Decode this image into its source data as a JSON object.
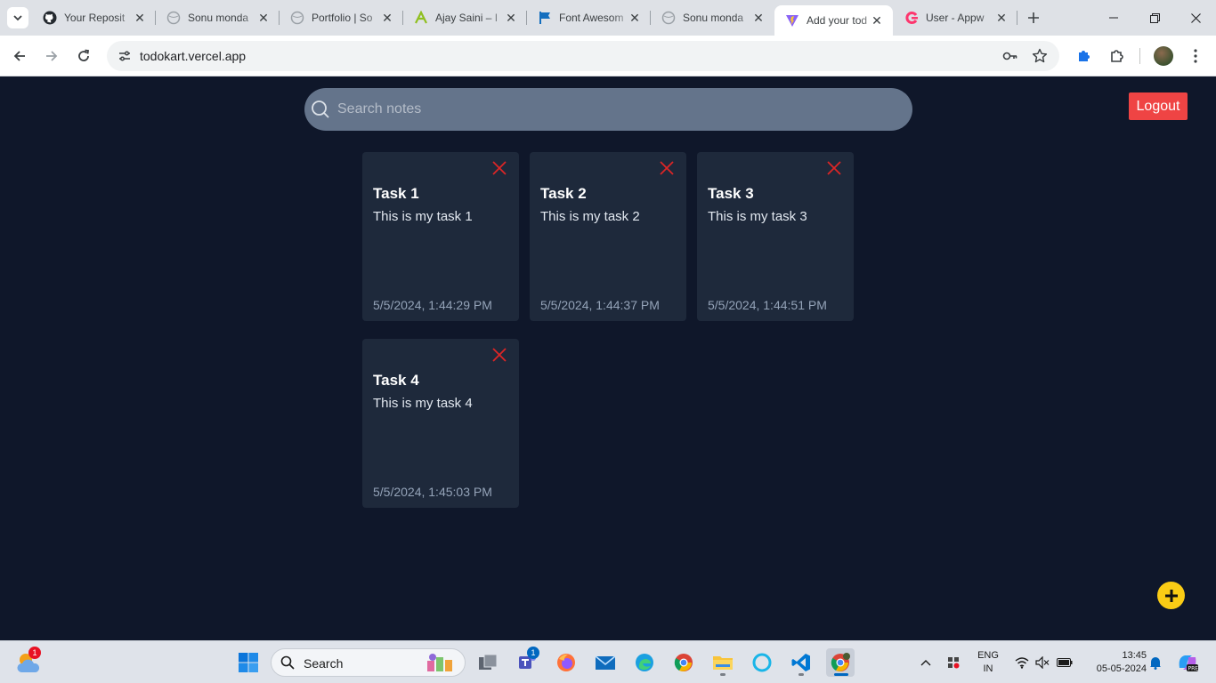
{
  "browser": {
    "tabs": [
      {
        "title": "Your Reposit",
        "icon": "github-icon",
        "active": false
      },
      {
        "title": "Sonu monda",
        "icon": "globe-icon",
        "active": false
      },
      {
        "title": "Portfolio | So",
        "icon": "globe-icon",
        "active": false
      },
      {
        "title": "Ajay Saini – I",
        "icon": "ajay-logo-icon",
        "active": false
      },
      {
        "title": "Font Awesom",
        "icon": "font-awesome-flag-icon",
        "active": false
      },
      {
        "title": "Sonu monda",
        "icon": "globe-icon",
        "active": false
      },
      {
        "title": "Add your tod",
        "icon": "vite-icon",
        "active": true
      },
      {
        "title": "User - Appw",
        "icon": "appwrite-icon",
        "active": false
      }
    ],
    "url": "todokart.vercel.app"
  },
  "app": {
    "search": {
      "placeholder": "Search notes",
      "value": ""
    },
    "logout_label": "Logout",
    "notes": [
      {
        "title": "Task 1",
        "body": "This is my task 1",
        "date": "5/5/2024, 1:44:29 PM"
      },
      {
        "title": "Task 2",
        "body": "This is my task 2",
        "date": "5/5/2024, 1:44:37 PM"
      },
      {
        "title": "Task 3",
        "body": "This is my task 3",
        "date": "5/5/2024, 1:44:51 PM"
      },
      {
        "title": "Task 4",
        "body": "This is my task 4",
        "date": "5/5/2024, 1:45:03 PM"
      }
    ],
    "colors": {
      "background": "#0f172a",
      "card": "#1e293b",
      "search": "#64748b",
      "logout": "#ef4444",
      "delete": "#dc2626",
      "fab": "#facc15"
    }
  },
  "taskbar": {
    "search_label": "Search",
    "weather_badge": "1",
    "teams_badge": "1",
    "apps": [
      "windows-start-icon",
      "task-view-icon",
      "teams-icon",
      "firefox-icon",
      "mail-icon",
      "edge-icon",
      "chrome-icon",
      "file-explorer-icon",
      "cortana-icon",
      "vscode-icon",
      "chrome-profile-icon"
    ],
    "lang_line1": "ENG",
    "lang_line2": "IN",
    "time": "13:45",
    "date": "05-05-2024"
  }
}
